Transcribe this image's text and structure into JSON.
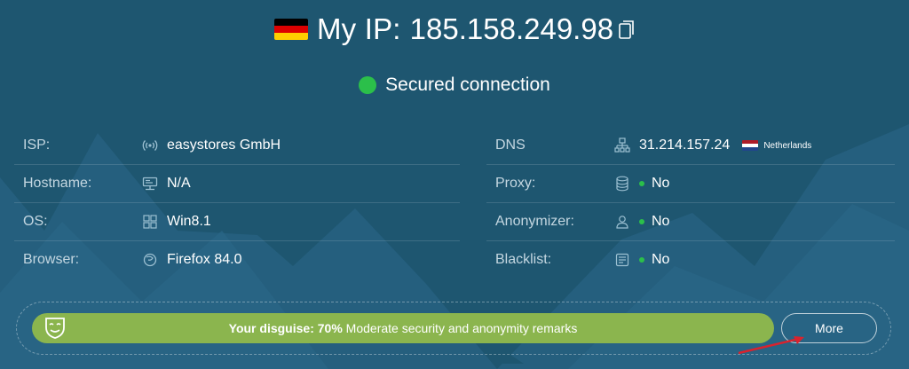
{
  "header": {
    "title_label": "My IP:",
    "ip_address": "185.158.249.98",
    "country_flag_colors": [
      "#000000",
      "#dd0000",
      "#ffce00"
    ]
  },
  "status": {
    "text": "Secured connection",
    "color": "#2bbf4a"
  },
  "left_rows": [
    {
      "label": "ISP:",
      "value": "easystores GmbH",
      "icon": "signal-icon"
    },
    {
      "label": "Hostname:",
      "value": "N/A",
      "icon": "server-icon"
    },
    {
      "label": "OS:",
      "value": "Win8.1",
      "icon": "windows-icon"
    },
    {
      "label": "Browser:",
      "value": "Firefox 84.0",
      "icon": "browser-icon"
    }
  ],
  "right_rows": [
    {
      "label": "DNS",
      "value": "31.214.157.24",
      "extra": "Netherlands",
      "icon": "network-icon"
    },
    {
      "label": "Proxy:",
      "value": "No",
      "icon": "database-icon"
    },
    {
      "label": "Anonymizer:",
      "value": "No",
      "icon": "user-icon"
    },
    {
      "label": "Blacklist:",
      "value": "No",
      "icon": "list-icon"
    }
  ],
  "disguise": {
    "label": "Your disguise:",
    "percent": "70%",
    "description": "Moderate security and anonymity remarks",
    "bar_color": "#8bb54e"
  },
  "more_button": {
    "label": "More"
  },
  "colors": {
    "background": "#1e5670",
    "mountain": "#286280",
    "annotation_arrow": "#d9232e"
  }
}
